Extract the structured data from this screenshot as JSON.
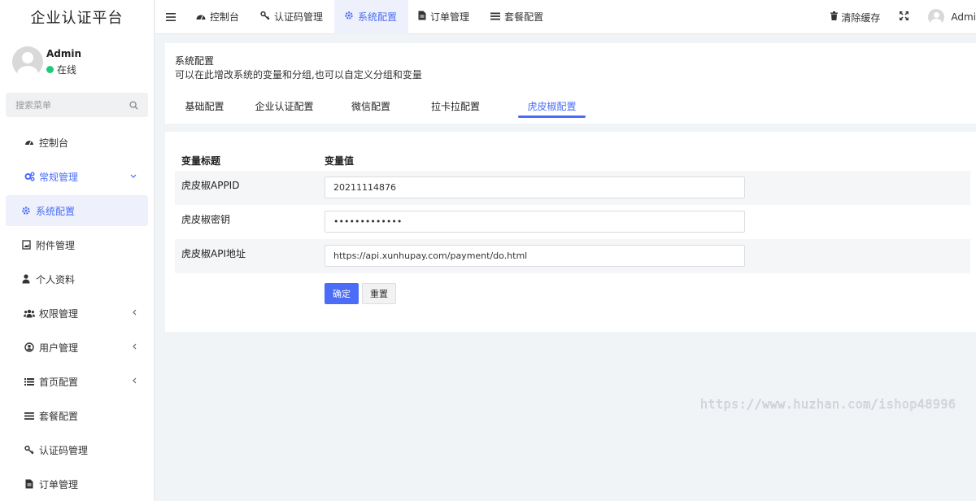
{
  "sidebar": {
    "brand": "企业认证平台",
    "user": {
      "name": "Admin",
      "status": "在线",
      "status_color": "#1ec97a"
    },
    "search": {
      "placeholder": "搜索菜单",
      "icon": "search-icon"
    },
    "items": [
      {
        "label": "控制台",
        "icon": "dashboard-icon"
      },
      {
        "label": "常规管理",
        "icon": "cogs-icon",
        "state": "open",
        "arrow": "chevron-down-icon"
      },
      {
        "label": "系统配置",
        "icon": "gear-icon",
        "state": "active"
      },
      {
        "label": "附件管理",
        "icon": "image-file-icon"
      },
      {
        "label": "个人资料",
        "icon": "user-icon"
      },
      {
        "label": "权限管理",
        "icon": "group-icon",
        "arrow": "chevron-left-icon"
      },
      {
        "label": "用户管理",
        "icon": "user-circle-icon",
        "arrow": "chevron-left-icon"
      },
      {
        "label": "首页配置",
        "icon": "list-icon",
        "arrow": "chevron-left-icon"
      },
      {
        "label": "套餐配置",
        "icon": "list-lines-icon"
      },
      {
        "label": "认证码管理",
        "icon": "key-icon"
      },
      {
        "label": "订单管理",
        "icon": "file-icon"
      }
    ]
  },
  "topbar": {
    "menu_icon": "hamburger-icon",
    "tabs": [
      {
        "label": "控制台",
        "icon": "dashboard-icon"
      },
      {
        "label": "认证码管理",
        "icon": "key-icon"
      },
      {
        "label": "系统配置",
        "icon": "gear-icon",
        "active": true
      },
      {
        "label": "订单管理",
        "icon": "file-icon"
      },
      {
        "label": "套餐配置",
        "icon": "list-lines-icon"
      }
    ],
    "right": {
      "clear_cache": "清除缓存",
      "clear_cache_icon": "trash-icon",
      "fullscreen_icon": "expand-icon",
      "user": "Admi"
    }
  },
  "panel": {
    "title": "系统配置",
    "description": "可以在此增改系统的变量和分组,也可以自定义分组和变量",
    "tabs": [
      "基础配置",
      "企业认证配置",
      "微信配置",
      "拉卡拉配置",
      "虎皮椒配置"
    ],
    "active_tab": "虎皮椒配置"
  },
  "form": {
    "header": {
      "title_col": "变量标题",
      "value_col": "变量值"
    },
    "rows": [
      {
        "label": "虎皮椒APPID",
        "value": "20211114876",
        "type": "text"
      },
      {
        "label": "虎皮椒密钥",
        "value": "•••••••••••••",
        "type": "password"
      },
      {
        "label": "虎皮椒API地址",
        "value": "https://api.xunhupay.com/payment/do.html",
        "type": "text"
      }
    ],
    "submit_label": "确定",
    "reset_label": "重置"
  },
  "watermark": "https://www.huzhan.com/ishop48996",
  "colors": {
    "accent": "#4a6cf7",
    "active_bg": "#eef1fb",
    "page_bg": "#f1f4f6"
  }
}
